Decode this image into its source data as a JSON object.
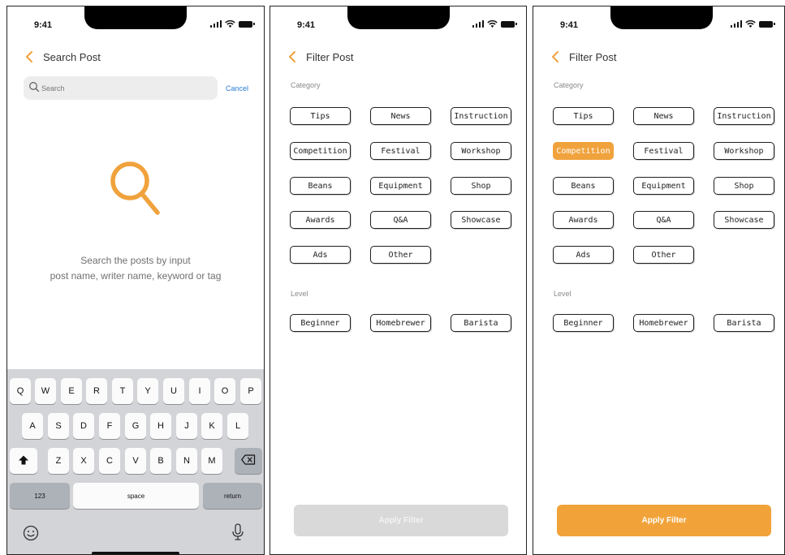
{
  "colors": {
    "accent": "#F0A23C",
    "link": "#2A7BD4",
    "disabled_button": "#D9D9D9",
    "keyboard_bg": "#D2D4D8"
  },
  "status_bar": {
    "time": "9:41"
  },
  "search_screen": {
    "title": "Search Post",
    "search_placeholder": "Search",
    "cancel_label": "Cancel",
    "hint_line1": "Search the posts by input",
    "hint_line2": "post name, writer name, keyword or tag",
    "keyboard": {
      "row1": [
        "Q",
        "W",
        "E",
        "R",
        "T",
        "Y",
        "U",
        "I",
        "O",
        "P"
      ],
      "row2": [
        "A",
        "S",
        "D",
        "F",
        "G",
        "H",
        "J",
        "K",
        "L"
      ],
      "row3": [
        "Z",
        "X",
        "C",
        "V",
        "B",
        "N",
        "M"
      ],
      "numbers_label": "123",
      "space_label": "space",
      "return_label": "return",
      "shift_icon": "shift-icon",
      "delete_icon": "backspace-icon",
      "emoji_icon": "emoji-icon",
      "mic_icon": "microphone-icon"
    }
  },
  "filter_screen": {
    "title": "Filter Post",
    "category_label": "Category",
    "level_label": "Level",
    "categories": [
      "Tips",
      "News",
      "Instruction",
      "Competition",
      "Festival",
      "Workshop",
      "Beans",
      "Equipment",
      "Shop",
      "Awards",
      "Q&A",
      "Showcase",
      "Ads",
      "Other"
    ],
    "levels": [
      "Beginner",
      "Homebrewer",
      "Barista"
    ],
    "apply_label": "Apply Filter"
  },
  "filter_screen_selected": {
    "selected_category": "Competition",
    "apply_state": "enabled"
  }
}
